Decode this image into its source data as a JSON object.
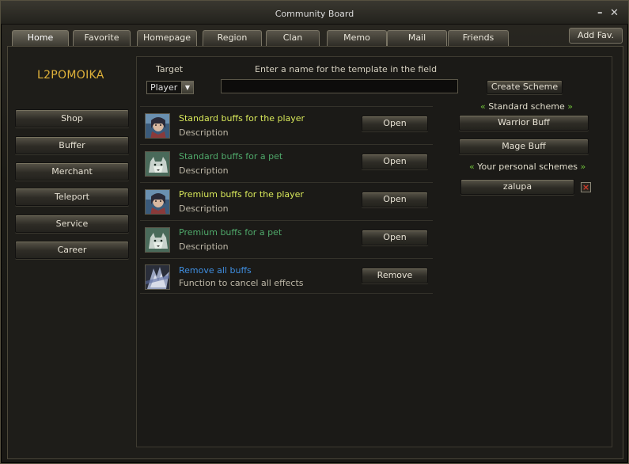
{
  "window": {
    "title": "Community Board"
  },
  "tabs": [
    {
      "label": "Home",
      "active": true
    },
    {
      "label": "Favorite",
      "active": false
    },
    {
      "label": "Homepage",
      "active": false
    },
    {
      "label": "Region",
      "active": false
    },
    {
      "label": "Clan",
      "active": false
    },
    {
      "label": "Memo",
      "active": false
    },
    {
      "label": "Mail",
      "active": false
    },
    {
      "label": "Friends",
      "active": false
    }
  ],
  "add_fav": "Add Fav.",
  "brand": "L2POMOIKA",
  "sidebar": [
    {
      "label": "Shop"
    },
    {
      "label": "Buffer"
    },
    {
      "label": "Merchant"
    },
    {
      "label": "Teleport"
    },
    {
      "label": "Service"
    },
    {
      "label": "Career"
    }
  ],
  "form": {
    "target_label": "Target",
    "target_value": "Player",
    "name_hint": "Enter a name for the template in the field",
    "name_value": "",
    "create_button": "Create Scheme"
  },
  "buff_rows": [
    {
      "title": "Standard buffs for the player",
      "title_color": "#d8e85a",
      "desc": "Description",
      "button": "Open",
      "icon": "mystic-portrait-icon"
    },
    {
      "title": "Standard buffs for a pet",
      "title_color": "#4fa86a",
      "desc": "Description",
      "button": "Open",
      "icon": "wolf-pet-icon"
    },
    {
      "title": "Premium buffs for the player",
      "title_color": "#d8e85a",
      "desc": "Description",
      "button": "Open",
      "icon": "mystic-portrait-icon"
    },
    {
      "title": "Premium buffs for a pet",
      "title_color": "#4fa86a",
      "desc": "Description",
      "button": "Open",
      "icon": "wolf-pet-icon"
    },
    {
      "title": "Remove all buffs",
      "title_color": "#3f8ee0",
      "desc": "Function to cancel all effects",
      "button": "Remove",
      "icon": "cancel-effects-icon"
    }
  ],
  "schemes": {
    "standard_label": "Standard scheme",
    "standard": [
      {
        "label": "Warrior Buff"
      },
      {
        "label": "Mage Buff"
      }
    ],
    "personal_label": "Your personal schemes",
    "personal": [
      {
        "label": "zalupa"
      }
    ],
    "delete_glyph": "×",
    "quote_left": "«",
    "quote_right": "»"
  }
}
